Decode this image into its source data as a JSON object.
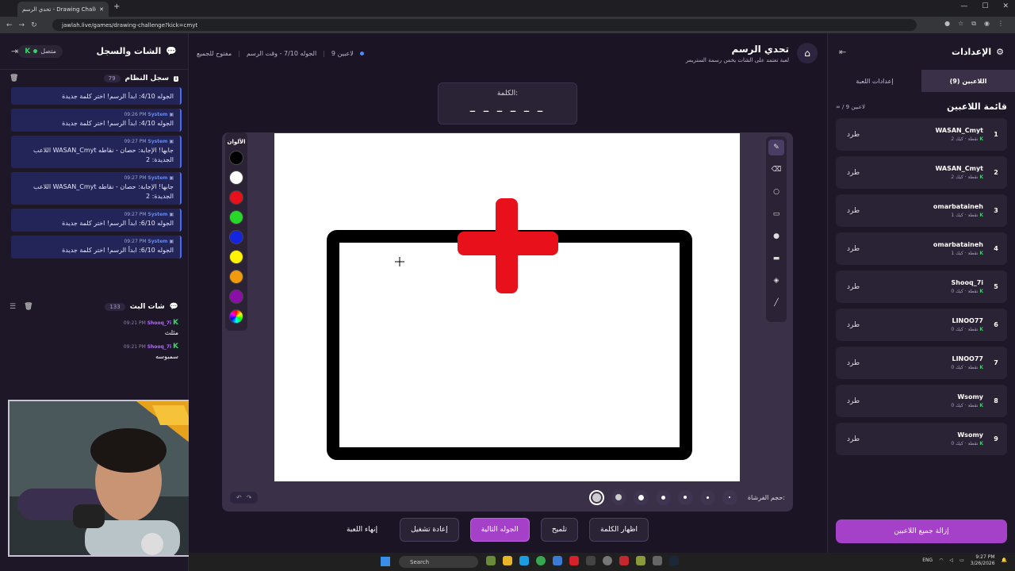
{
  "browser": {
    "tab_title": "تحدي الرسم - Drawing Challenge",
    "url": "jawlah.live/games/drawing-challenge?kick=cmyt"
  },
  "left": {
    "title": "الشات والسجل",
    "status": "متصل",
    "log_title": "سجل النظام",
    "log_count": "79",
    "logs": [
      {
        "time": "",
        "user": "",
        "text": "الجوله 4/10: ابدأ الرسم! اختر كلمة جديدة"
      },
      {
        "time": "09:26 PM",
        "user": "System",
        "text": "الجوله 4/10: ابدأ الرسم! اختر كلمة جديدة"
      },
      {
        "time": "09:27 PM",
        "user": "System",
        "text": "اللاعب WASAN_Cmyt جابها! الإجابة: حصان - نقاطه الجديدة: 2"
      },
      {
        "time": "09:27 PM",
        "user": "System",
        "text": "اللاعب WASAN_Cmyt جابها! الإجابة: حصان - نقاطه الجديدة: 2"
      },
      {
        "time": "09:27 PM",
        "user": "System",
        "text": "الجوله 6/10: ابدأ الرسم! اختر كلمة جديدة"
      },
      {
        "time": "09:27 PM",
        "user": "System",
        "text": "الجوله 6/10: ابدأ الرسم! اختر كلمة جديدة"
      }
    ],
    "chat_title": "شات البث",
    "chat_count": "133",
    "chat": [
      {
        "time": "09:21 PM",
        "user": "Shooq_7i",
        "text": "مثلث"
      },
      {
        "time": "09:21 PM",
        "user": "Shooq_7i",
        "text": "سمبوسه"
      }
    ]
  },
  "game": {
    "title": "تحدي الرسم",
    "subtitle": "لعبة تعتمد على الشات يخمن رسمة الستريمر",
    "players": "9 لاعبين",
    "round": "الجوله 7/10 - وقت الرسم",
    "mode": "مفتوح للجميع",
    "word_label": "الكلمة:",
    "word_blanks": "_ _ _ _ _ _",
    "colors_label": "الألوان",
    "brush_size_label": "حجم الفرشاة:",
    "buttons": {
      "show_word": "اظهار الكلمة",
      "hint": "تلميح",
      "next_round": "الجوله التالية",
      "restart": "إعادة تشغيل",
      "end_game": "إنهاء اللعبة"
    }
  },
  "palette": [
    "#000000",
    "#ffffff",
    "#e8101a",
    "#27d82b",
    "#1424e0",
    "#fff200",
    "#f29a0d",
    "#8a0fa8"
  ],
  "right": {
    "title": "الإعدادات",
    "tab_players": "اللاعبين (9)",
    "tab_settings": "إعدادات اللعبة",
    "list_title": "قائمة اللاعبين",
    "list_count": "∞ / 9 لاعبين",
    "kick_label": "طرد",
    "points_word": "نقطة",
    "platform": "كيك",
    "players": [
      {
        "rank": "1",
        "name": "WASAN_Cmyt",
        "points": "2"
      },
      {
        "rank": "2",
        "name": "WASAN_Cmyt",
        "points": "2"
      },
      {
        "rank": "3",
        "name": "omarbataineh",
        "points": "1"
      },
      {
        "rank": "4",
        "name": "omarbataineh",
        "points": "1"
      },
      {
        "rank": "5",
        "name": "Shooq_7i",
        "points": "0"
      },
      {
        "rank": "6",
        "name": "LINOO77",
        "points": "0"
      },
      {
        "rank": "7",
        "name": "LINOO77",
        "points": "0"
      },
      {
        "rank": "8",
        "name": "Wsomy",
        "points": "0"
      },
      {
        "rank": "9",
        "name": "Wsomy",
        "points": "0"
      }
    ],
    "remove_all": "إزالة جميع اللاعبين"
  },
  "taskbar": {
    "search": "Search",
    "lang": "ENG",
    "time": "9:27 PM",
    "date": "3/26/2026"
  }
}
